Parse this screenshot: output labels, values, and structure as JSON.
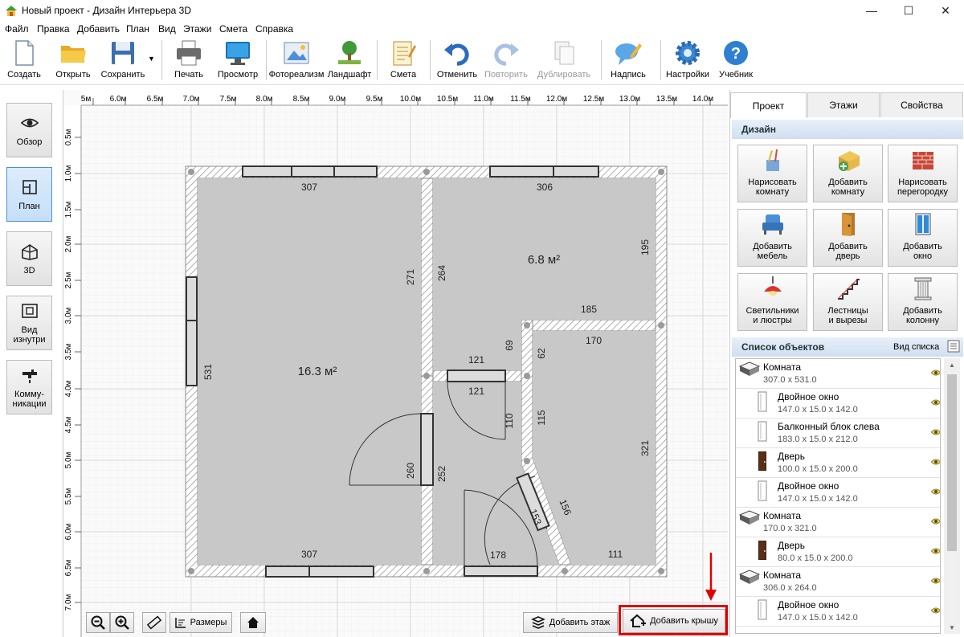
{
  "window": {
    "title": "Новый проект - Дизайн Интерьера 3D",
    "controls": [
      "—",
      "☐",
      "✕"
    ]
  },
  "menu": [
    "Файл",
    "Правка",
    "Добавить",
    "План",
    "Вид",
    "Этажи",
    "Смета",
    "Справка"
  ],
  "toolbar": {
    "create": "Создать",
    "open": "Открыть",
    "save": "Сохранить",
    "print": "Печать",
    "preview": "Просмотр",
    "photo": "Фотореализм",
    "landscape": "Ландшафт",
    "estimate": "Смета",
    "undo": "Отменить",
    "redo": "Повторить",
    "duplicate": "Дублировать",
    "caption": "Надпись",
    "settings": "Настройки",
    "tutorial": "Учебник"
  },
  "left_tools": {
    "overview": "Обзор",
    "plan": "План",
    "view3d": "3D",
    "inside_1": "Вид",
    "inside_2": "изнутри",
    "utilities_1": "Комму-",
    "utilities_2": "никации"
  },
  "ruler": {
    "x_ticks": [
      "5м",
      "6.0м",
      "6.5м",
      "7.0м",
      "7.5м",
      "8.0м",
      "8.5м",
      "9.0м",
      "9.5м",
      "10.0м",
      "10.5м",
      "11.0м",
      "11.5м",
      "12.0м",
      "12.5м",
      "13.0м",
      "13.5м",
      "14.0м"
    ],
    "y_ticks": [
      "0.5м",
      "1.0м",
      "1.5м",
      "2.0м",
      "2.5м",
      "3.0м",
      "3.5м",
      "4.0м",
      "4.5м",
      "5.0м",
      "5.5м",
      "6.0м",
      "6.5м",
      "7.0м"
    ]
  },
  "plan": {
    "room_big_area": "16.3 м²",
    "room_right_area": "6.8 м²",
    "dims": {
      "top_left": "307",
      "top_right": "306",
      "left_side": "531",
      "right_top": "195",
      "right_bottom": "321",
      "inner_271": "271",
      "inner_264": "264",
      "d185": "185",
      "d170": "170",
      "d69": "69",
      "d62": "62",
      "d121a": "121",
      "d121b": "121",
      "d110": "110",
      "d115": "115",
      "d260": "260",
      "d252": "252",
      "d153": "153",
      "d156": "156",
      "bottom_left": "307",
      "d178": "178",
      "d111": "111"
    }
  },
  "canvas_buttons": {
    "dimensions": "Размеры",
    "add_floor": "Добавить этаж",
    "add_roof": "Добавить крышу"
  },
  "right_panel": {
    "tabs": [
      "Проект",
      "Этажи",
      "Свойства"
    ],
    "design_header": "Дизайн",
    "design_buttons": [
      {
        "l1": "Нарисовать",
        "l2": "комнату"
      },
      {
        "l1": "Добавить",
        "l2": "комнату"
      },
      {
        "l1": "Нарисовать",
        "l2": "перегородку"
      },
      {
        "l1": "Добавить",
        "l2": "мебель"
      },
      {
        "l1": "Добавить",
        "l2": "дверь"
      },
      {
        "l1": "Добавить",
        "l2": "окно"
      },
      {
        "l1": "Светильники",
        "l2": "и люстры"
      },
      {
        "l1": "Лестницы",
        "l2": "и вырезы"
      },
      {
        "l1": "Добавить",
        "l2": "колонну"
      }
    ],
    "objects_header": "Список объектов",
    "view_list": "Вид списка",
    "objects": [
      {
        "name": "Комната",
        "dims": "307.0 x 531.0",
        "type": "room"
      },
      {
        "name": "Двойное окно",
        "dims": "147.0 x 15.0 x 142.0",
        "type": "window"
      },
      {
        "name": "Балконный блок слева",
        "dims": "183.0 x 15.0 x 212.0",
        "type": "window"
      },
      {
        "name": "Дверь",
        "dims": "100.0 x 15.0 x 200.0",
        "type": "door"
      },
      {
        "name": "Двойное окно",
        "dims": "147.0 x 15.0 x 142.0",
        "type": "window"
      },
      {
        "name": "Комната",
        "dims": "170.0 x 321.0",
        "type": "room"
      },
      {
        "name": "Дверь",
        "dims": "80.0 x 15.0 x 200.0",
        "type": "door"
      },
      {
        "name": "Комната",
        "dims": "306.0 x 264.0",
        "type": "room"
      },
      {
        "name": "Двойное окно",
        "dims": "147.0 x 15.0 x 142.0",
        "type": "window"
      }
    ]
  },
  "colors": {
    "accent": "#4a90d9",
    "highlight": "#e00000",
    "floor": "#c8c8c8",
    "wall_hatch": "#9a9a9a"
  }
}
